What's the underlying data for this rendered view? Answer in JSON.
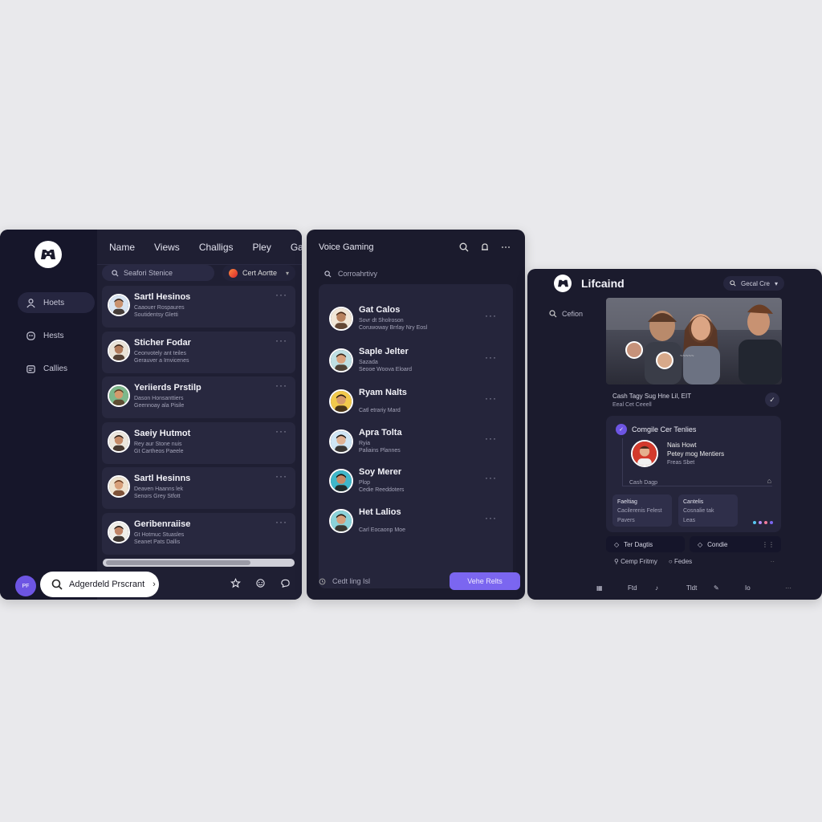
{
  "panel1": {
    "rail": {
      "items": [
        {
          "label": "Hoets",
          "icon": "person-icon"
        },
        {
          "label": "Hests",
          "icon": "group-icon"
        },
        {
          "label": "Callies",
          "icon": "calendar-icon"
        }
      ]
    },
    "nav": [
      "Name",
      "Views",
      "Challigs",
      "Pley",
      "Gart"
    ],
    "search_placeholder": "Seafori Stenice",
    "filter": {
      "label": "Cert Aortte",
      "arrow": "▾"
    },
    "conversations": [
      {
        "name": "Sartl Hesinos",
        "line1": "Caaouer Rospaures",
        "line2": "Soutidentsy Gletti",
        "avatar": "a1"
      },
      {
        "name": "Sticher Fodar",
        "line1": "Ceonvotely ant teiles",
        "line2": "Gerauver a Imvicenes",
        "avatar": "a2"
      },
      {
        "name": "Yeriierds Prstilp",
        "line1": "Dason Honsanttiers",
        "line2": "Geennoay ala Pisile",
        "avatar": "a3"
      },
      {
        "name": "Saeiy Hutmot",
        "line1": "Rey aur Stone nuis",
        "line2": "Gt Cartheos Paeele",
        "avatar": "a4"
      },
      {
        "name": "Sartl Hesinns",
        "line1": "Deaven Haanns lek",
        "line2": "Senors Grey Stfott",
        "avatar": "a5"
      },
      {
        "name": "Geribenraiise",
        "line1": "Gt Hotmuc Stuasles",
        "line2": "Seanet Pats Dallis",
        "avatar": "a6"
      }
    ],
    "footer": {
      "badge": "PF",
      "search_label": "Adgerdeld Prscrant",
      "search_chev": "›"
    }
  },
  "panel2": {
    "title": "Voice Gaming",
    "search_placeholder": "Corroahrtivy",
    "contacts": [
      {
        "name": "Gat Calos",
        "line1": "Sovr dt Sholroson",
        "line2": "Coruwoway Brrlay Nry Eosl",
        "avatar": "b1"
      },
      {
        "name": "Saple Jelter",
        "line1": "Sazada",
        "line2": "Seooe Woova Eloard",
        "avatar": "b2"
      },
      {
        "name": "Ryam Nalts",
        "line1": "",
        "line2": "Catl etrariy Mard",
        "avatar": "b3"
      },
      {
        "name": "Apra Tolta",
        "line1": "Ryia",
        "line2": "Paliains Plannes",
        "avatar": "b4"
      },
      {
        "name": "Soy Merer",
        "line1": "Plop",
        "line2": "Cedie Reeddoters",
        "avatar": "b5"
      },
      {
        "name": "Het Lalios",
        "line1": "",
        "line2": "Carl Eocaonp Moe",
        "avatar": "b6"
      }
    ],
    "footer_text": "Cedt ling Isl",
    "voice_button": "Vehe Relts"
  },
  "panel3": {
    "title": "Lifcaind",
    "dropdown": "Gecal Cre",
    "side_search": "Cefion",
    "hero_caption": {
      "line1": "Cash Tagy Sug Hne Lil, EIT",
      "line2": "Eeal Cet Ceeell",
      "check": "✓"
    },
    "feature": {
      "badge": "✓",
      "title": "Comgile Cer Tenlies",
      "n1": "Nais Howt",
      "n2": "Petey mog Mentiers",
      "n3": "Freas Sbet",
      "sub": "Cash Dagp",
      "tiles": [
        {
          "title": "Faeltiag",
          "l1": "Cacilerenis Felest",
          "l2": "Pavers"
        },
        {
          "title": "Cantelis",
          "l1": "Cosnalie tak",
          "l2": "Leas"
        }
      ],
      "dot_colors": [
        "#58c7f2",
        "#b58cf5",
        "#f07a9a",
        "#7b66f0"
      ]
    },
    "tags": [
      {
        "label": "Ter Dagtis",
        "end": ""
      },
      {
        "label": "Condie",
        "end": "⋮⋮"
      }
    ],
    "info": [
      "Cemp Fritmy",
      "Fedes"
    ],
    "bottom": [
      {
        "icon": "grid-icon",
        "label": "Ftd"
      },
      {
        "icon": "bell-icon",
        "label": "Tldt"
      },
      {
        "icon": "pen-icon",
        "label": "Io"
      }
    ]
  },
  "colors": {
    "panel_bg": "#1b1b2d",
    "accent": "#7b66f0",
    "page_bg": "#e9e9ec"
  }
}
